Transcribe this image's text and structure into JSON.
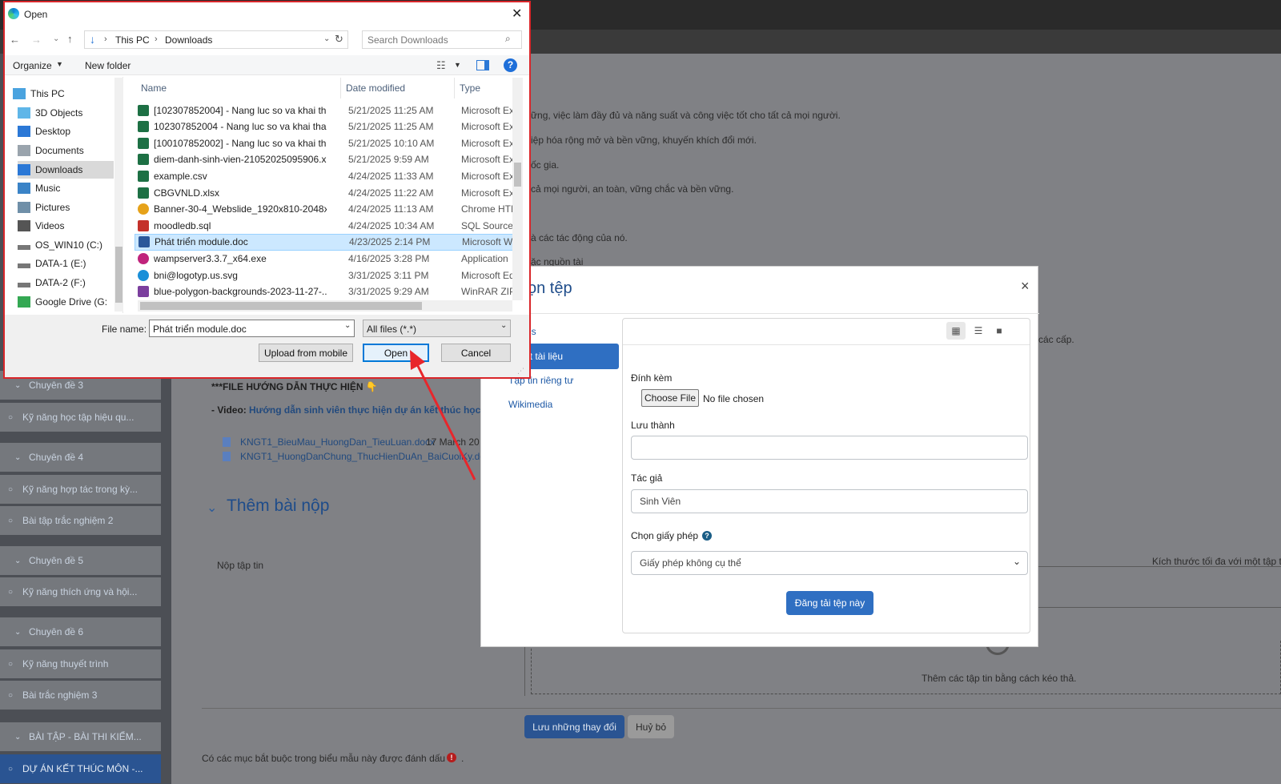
{
  "background_page": {
    "body_lines": [
      "ững, việc làm đầy đủ và năng suất và công việc tốt cho tất cả mọi người.",
      "iệp hóa rộng mở và bền vững, khuyến khích đổi mới.",
      "ốc gia.",
      "cả mọi người, an toàn, vững chắc và bền vững.",
      "à các tác động của nó.",
      "ặc nguồn tài",
      "à các cấp."
    ],
    "guide_title": "***FILE HƯỚNG DẪN THỰC HIỆN 👇",
    "video_prefix": "- Video: ",
    "video_link": "Hướng dẫn sinh viên thực hiện dự án kết thúc học p",
    "files": [
      {
        "name": "KNGT1_BieuMau_HuongDan_TieuLuan.docx",
        "date": "17 March 20"
      },
      {
        "name": "KNGT1_HuongDanChung_ThucHienDuAn_BaiCuoiKy.doc",
        "date": ""
      }
    ],
    "add_submission_title": "Thêm bài nộp",
    "upload_label": "Nộp tập tin",
    "max_size_label": "Kích thước tối đa với một tập ti",
    "drop_text": "Thêm các tập tin bằng cách kéo thả.",
    "save_button": "Lưu những thay đổi",
    "cancel_button": "Huỷ bỏ",
    "required_note": "Có các mục bắt buộc trong biểu mẫu này được đánh dấu",
    "required_dot": "."
  },
  "sidebar": {
    "items": [
      {
        "label": "Chuyên đề 3",
        "kind": "section"
      },
      {
        "label": "Kỹ năng học tập hiệu qu...",
        "kind": "activity"
      },
      {
        "label": "Chuyên đề 4",
        "kind": "section"
      },
      {
        "label": "Kỹ năng hợp tác trong kỳ...",
        "kind": "activity"
      },
      {
        "label": "Bài tập trắc nghiệm 2",
        "kind": "activity"
      },
      {
        "label": "Chuyên đề 5",
        "kind": "section"
      },
      {
        "label": "Kỹ năng thích ứng và hội...",
        "kind": "activity"
      },
      {
        "label": "Chuyên đề 6",
        "kind": "section"
      },
      {
        "label": "Kỹ năng thuyết trình",
        "kind": "activity"
      },
      {
        "label": "Bài trắc nghiệm 3",
        "kind": "activity"
      },
      {
        "label": "BÀI TẬP - BÀI THI KIỂM...",
        "kind": "section"
      },
      {
        "label": "DỰ ÁN KẾT THÚC MÔN -...",
        "kind": "activity-active"
      }
    ]
  },
  "upload_modal": {
    "title": "ọn tệp",
    "close": "×",
    "nav": [
      "nt files",
      "n một tài liệu",
      "Tập tin riêng tư",
      "Wikimedia"
    ],
    "attach_label": "Đính kèm",
    "choose_file_button": "Choose File",
    "no_file_text": "No file chosen",
    "save_as_label": "Lưu thành",
    "save_as_value": "",
    "author_label": "Tác giả",
    "author_value": "Sinh Viên",
    "license_label": "Chọn giấy phép",
    "license_value": "Giấy phép không cụ thể",
    "upload_button": "Đăng tải tệp này"
  },
  "open_dialog": {
    "title": "Open",
    "breadcrumb": [
      "This PC",
      "Downloads"
    ],
    "search_placeholder": "Search Downloads",
    "organize_label": "Organize",
    "new_folder_label": "New folder",
    "columns": {
      "name": "Name",
      "date": "Date modified",
      "type": "Type"
    },
    "tree": [
      {
        "label": "This PC",
        "icon": "pc-icon"
      },
      {
        "label": "3D Objects",
        "icon": "cube-icon"
      },
      {
        "label": "Desktop",
        "icon": "desktop-icon"
      },
      {
        "label": "Documents",
        "icon": "document-icon"
      },
      {
        "label": "Downloads",
        "icon": "download-icon"
      },
      {
        "label": "Music",
        "icon": "music-icon"
      },
      {
        "label": "Pictures",
        "icon": "pictures-icon"
      },
      {
        "label": "Videos",
        "icon": "video-icon"
      },
      {
        "label": "OS_WIN10 (C:)",
        "icon": "drive-icon"
      },
      {
        "label": "DATA-1 (E:)",
        "icon": "drive-icon"
      },
      {
        "label": "DATA-2 (F:)",
        "icon": "drive-icon"
      },
      {
        "label": "Google Drive (G:",
        "icon": "gdrive-icon"
      }
    ],
    "files": [
      {
        "name": "[102307852004] - Nang luc so va khai tha...",
        "date": "5/21/2025 11:25 AM",
        "type": "Microsoft Exc",
        "icon": "excel"
      },
      {
        "name": "102307852004 - Nang luc so va khai thac ...",
        "date": "5/21/2025 11:25 AM",
        "type": "Microsoft Exc",
        "icon": "excel"
      },
      {
        "name": "[100107852002] - Nang luc so va khai tha...",
        "date": "5/21/2025 10:10 AM",
        "type": "Microsoft Exc",
        "icon": "excel"
      },
      {
        "name": "diem-danh-sinh-vien-21052025095906.xls",
        "date": "5/21/2025 9:59 AM",
        "type": "Microsoft Exc",
        "icon": "excel"
      },
      {
        "name": "example.csv",
        "date": "4/24/2025 11:33 AM",
        "type": "Microsoft Exc",
        "icon": "excel"
      },
      {
        "name": "CBGVNLD.xlsx",
        "date": "4/24/2025 11:22 AM",
        "type": "Microsoft Exc",
        "icon": "excel"
      },
      {
        "name": "Banner-30-4_Webslide_1920x810-2048x8...",
        "date": "4/24/2025 11:13 AM",
        "type": "Chrome HTM",
        "icon": "chrome"
      },
      {
        "name": "moodledb.sql",
        "date": "4/24/2025 10:34 AM",
        "type": "SQL Source F",
        "icon": "sql"
      },
      {
        "name": "Phát triển module.doc",
        "date": "4/23/2025 2:14 PM",
        "type": "Microsoft Wo",
        "icon": "word",
        "selected": true
      },
      {
        "name": "wampserver3.3.7_x64.exe",
        "date": "4/16/2025 3:28 PM",
        "type": "Application",
        "icon": "exe"
      },
      {
        "name": "bni@logotyp.us.svg",
        "date": "3/31/2025 3:11 PM",
        "type": "Microsoft Ed",
        "icon": "edge"
      },
      {
        "name": "blue-polygon-backgrounds-2023-11-27-...",
        "date": "3/31/2025 9:29 AM",
        "type": "WinRAR ZIP a",
        "icon": "rar"
      }
    ],
    "file_name_label": "File name:",
    "file_name_value": "Phát triển module.doc",
    "file_type_value": "All files (*.*)",
    "upload_mobile_button": "Upload from mobile",
    "open_button": "Open",
    "cancel_button": "Cancel"
  },
  "colors": {
    "dialog_border": "#d9262a",
    "selected_row": "#cce8ff",
    "primary_button": "#2f6fc2",
    "link": "#224a7e",
    "arrow": "#e8262b"
  }
}
